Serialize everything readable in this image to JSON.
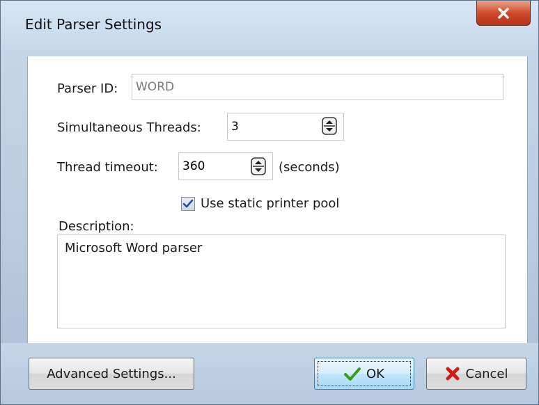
{
  "window": {
    "title": "Edit Parser Settings",
    "close_icon": "close-icon"
  },
  "form": {
    "parser_id_label": "Parser ID:",
    "parser_id_value": "WORD",
    "threads_label": "Simultaneous Threads:",
    "threads_value": "3",
    "timeout_label": "Thread timeout:",
    "timeout_value": "360",
    "timeout_unit": "(seconds)",
    "printer_pool_label": "Use static printer pool",
    "printer_pool_checked": true,
    "description_label": "Description:",
    "description_value": "Microsoft Word parser"
  },
  "buttons": {
    "advanced_label": "Advanced Settings...",
    "ok_label": "OK",
    "ok_icon": "checkmark-icon",
    "cancel_label": "Cancel",
    "cancel_icon": "red-x-icon"
  },
  "colors": {
    "accent_frame": "#c3d6ea",
    "close_button": "#cf4b2c",
    "ok_check": "#3a9a1c",
    "cancel_x": "#d11b1b"
  }
}
